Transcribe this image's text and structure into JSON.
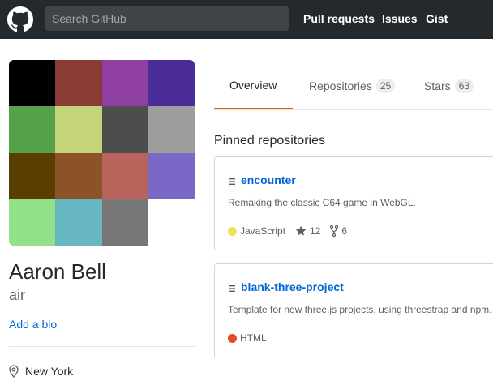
{
  "header": {
    "search_placeholder": "Search GitHub",
    "nav": [
      "Pull requests",
      "Issues",
      "Gist"
    ]
  },
  "profile": {
    "avatar_colors": [
      "#000000",
      "#8a3b33",
      "#8f3fa0",
      "#4a2d96",
      "#56a24b",
      "#c4d47a",
      "#4d4d4d",
      "#9e9e9e",
      "#5a3d00",
      "#8c5328",
      "#b8635c",
      "#7a67c6",
      "#93e08b",
      "#66b7c0",
      "#777777",
      "#ffffff"
    ],
    "fullname": "Aaron Bell",
    "username": "air",
    "add_bio": "Add a bio",
    "location": "New York"
  },
  "tabs": [
    {
      "label": "Overview",
      "count": ""
    },
    {
      "label": "Repositories",
      "count": "25"
    },
    {
      "label": "Stars",
      "count": "63"
    }
  ],
  "pinned": {
    "title": "Pinned repositories",
    "repos": [
      {
        "name": "encounter",
        "description": "Remaking the classic C64 game in WebGL.",
        "language": "JavaScript",
        "language_color": "#f1e05a",
        "stars": "12",
        "forks": "6"
      },
      {
        "name": "blank-three-project",
        "description": "Template for new three.js projects, using threestrap and npm.",
        "language": "HTML",
        "language_color": "#e34c26"
      }
    ]
  }
}
